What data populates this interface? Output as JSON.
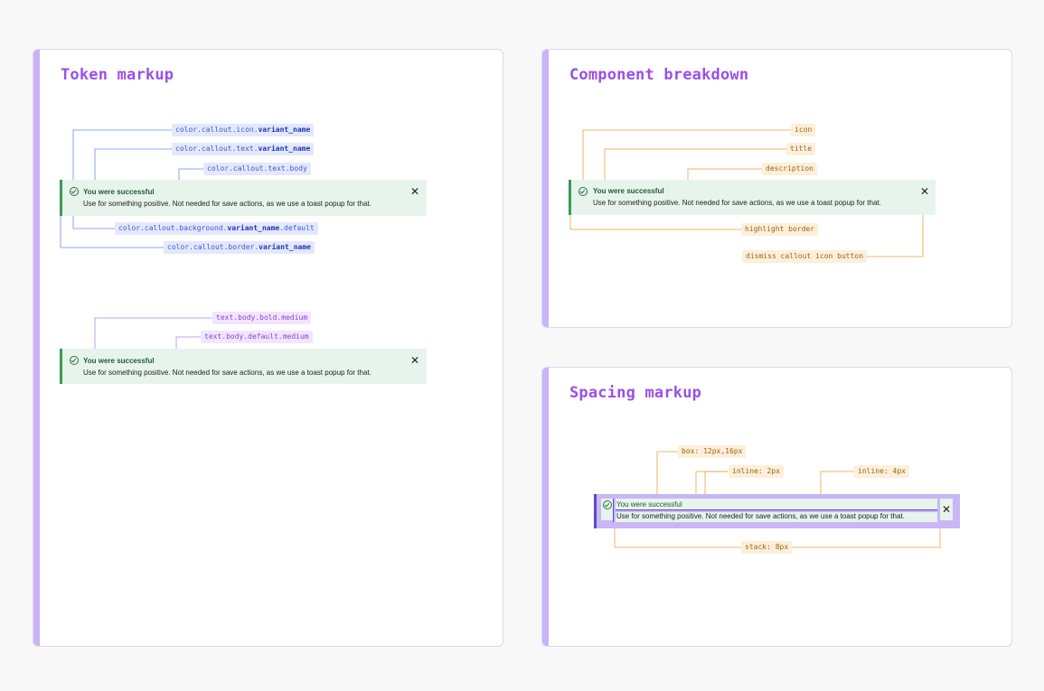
{
  "callout": {
    "title": "You were successful",
    "description": "Use for something positive. Not needed for save actions, as we use a toast popup for that.",
    "close_glyph": "✕",
    "icon": "check-circle-icon"
  },
  "token_markup": {
    "title": "Token markup",
    "tags": {
      "icon_color": {
        "prefix": "color.callout.icon.",
        "bold": "variant_name",
        "suffix": ""
      },
      "title_color": {
        "prefix": "color.callout.text.",
        "bold": "variant_name",
        "suffix": ""
      },
      "body_color": "color.callout.text.body",
      "background": {
        "prefix": "color.callout.background.",
        "bold": "variant_name",
        "suffix": ".default"
      },
      "border": {
        "prefix": "color.callout.border.",
        "bold": "variant_name",
        "suffix": ""
      },
      "bold_text": "text.body.bold.medium",
      "default_text": "text.body.default.medium"
    }
  },
  "component_breakdown": {
    "title": "Component breakdown",
    "labels": {
      "icon": "icon",
      "title": "title",
      "description": "description",
      "highlight_border": "highlight border",
      "dismiss": "dismiss callout icon button"
    }
  },
  "spacing_markup": {
    "title": "Spacing markup",
    "labels": {
      "box": "box: 12px,16px",
      "inline_2": "inline: 2px",
      "inline_4": "inline: 4px",
      "stack": "stack: 8px"
    }
  },
  "colors": {
    "title_purple": "#9b4fe8",
    "card_stripe": "#cbb2f5",
    "callout_bg": "#e7f4ec",
    "callout_border": "#3c9a58",
    "token_blue": "#3a5ad9",
    "token_purple": "#8a42d8",
    "annotation_orange": "#e8a33a",
    "spacing_purple": "#c8b6f6"
  }
}
